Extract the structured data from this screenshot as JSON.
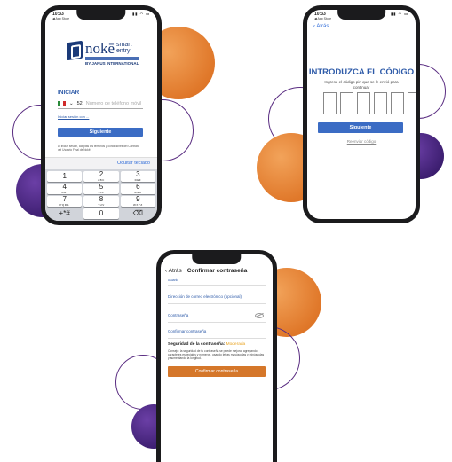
{
  "phone1": {
    "status": {
      "time": "10:33",
      "back_app": "◀ App Store"
    },
    "logo": {
      "brand": "nokē",
      "tagline_1": "smart",
      "tagline_2": "entry",
      "maker": "BY JANUS INTERNATIONAL"
    },
    "login": {
      "title": "INICIAR",
      "country_code": "52",
      "phone_placeholder": "Número de teléfono móvil",
      "alt_link": "Iniciar sesión con ...",
      "next_button": "Siguiente",
      "fine_print": "Al iniciar sesión, aceptas los términos y condiciones del Contrato del Usuario Final de Nokē."
    },
    "keyboard": {
      "hide_label": "Ocultar teclado",
      "keys": [
        {
          "num": "1",
          "letters": ""
        },
        {
          "num": "2",
          "letters": "ABC"
        },
        {
          "num": "3",
          "letters": "DEF"
        },
        {
          "num": "4",
          "letters": "GHI"
        },
        {
          "num": "5",
          "letters": "JKL"
        },
        {
          "num": "6",
          "letters": "MNO"
        },
        {
          "num": "7",
          "letters": "PQRS"
        },
        {
          "num": "8",
          "letters": "TUV"
        },
        {
          "num": "9",
          "letters": "WXYZ"
        },
        {
          "num": "+*#",
          "letters": ""
        },
        {
          "num": "0",
          "letters": ""
        },
        {
          "num": "⌫",
          "letters": ""
        }
      ]
    }
  },
  "phone2": {
    "status": {
      "time": "10:33",
      "back_app": "◀ App Store"
    },
    "back": "‹ Atrás",
    "title": "INTRODUZCA EL CÓDIGO",
    "subtitle": "Ingrese el código pin que se le envió para continuar",
    "next_button": "Siguiente",
    "resend": "Reenviar código"
  },
  "phone3": {
    "back": "‹ Atrás",
    "title": "Confirmar contraseña",
    "top_small": "usuario",
    "email_label": "Dirección de correo electrónico (opcional)",
    "password_label": "Contraseña",
    "confirm_label": "Confirmar contraseña",
    "strength_label": "Seguridad de la contraseña:",
    "strength_value": "Moderada",
    "advice": "Consejo: la seguridad de tu contraseña se puede mejorar agregando caracteres especiales y números, usando letras mayúsculas y minúsculas y aumentando la longitud.",
    "confirm_button": "Confirmar contraseña"
  },
  "colors": {
    "orange": "#e0782a",
    "purple": "#3b1d6e",
    "brand_blue": "#2d5aa8",
    "button_blue": "#3b6cc4",
    "confirm_orange": "#d5772a"
  }
}
